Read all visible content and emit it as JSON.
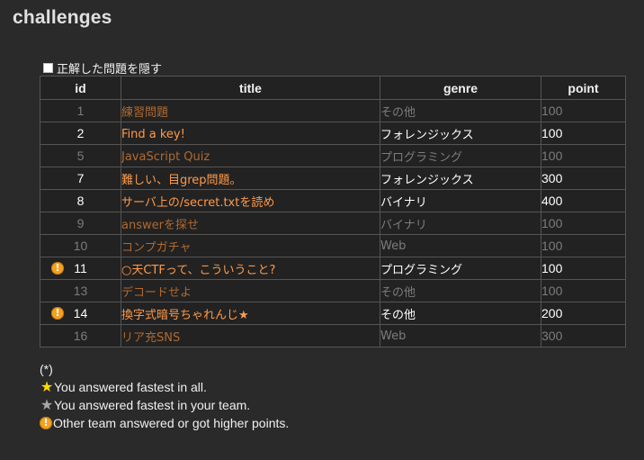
{
  "page": {
    "title": "challenges"
  },
  "filter": {
    "hide_solved_label": "正解した問題を隠す",
    "hide_solved_checked": false
  },
  "table": {
    "headers": {
      "id": "id",
      "title": "title",
      "genre": "genre",
      "point": "point"
    },
    "rows": [
      {
        "id": "1",
        "title": "練習問題",
        "genre": "その他",
        "point": "100",
        "solved": true,
        "warning": false
      },
      {
        "id": "2",
        "title": "Find a key!",
        "genre": "フォレンジックス",
        "point": "100",
        "solved": false,
        "warning": false
      },
      {
        "id": "5",
        "title": "JavaScript Quiz",
        "genre": "プログラミング",
        "point": "100",
        "solved": true,
        "warning": false
      },
      {
        "id": "7",
        "title": "難しい、目grep問題。",
        "genre": "フォレンジックス",
        "point": "300",
        "solved": false,
        "warning": false
      },
      {
        "id": "8",
        "title": "サーバ上の/secret.txtを読め",
        "genre": "バイナリ",
        "point": "400",
        "solved": false,
        "warning": false
      },
      {
        "id": "9",
        "title": "answerを探せ",
        "genre": "バイナリ",
        "point": "100",
        "solved": true,
        "warning": false
      },
      {
        "id": "10",
        "title": "コンプガチャ",
        "genre": "Web",
        "point": "100",
        "solved": true,
        "warning": false
      },
      {
        "id": "11",
        "title": "○天CTFって、こういうこと?",
        "genre": "プログラミング",
        "point": "100",
        "solved": false,
        "warning": true
      },
      {
        "id": "13",
        "title": "デコードせよ",
        "genre": "その他",
        "point": "100",
        "solved": true,
        "warning": false
      },
      {
        "id": "14",
        "title": "換字式暗号ちゃれんじ★",
        "genre": "その他",
        "point": "200",
        "solved": false,
        "warning": true
      },
      {
        "id": "16",
        "title": "リア充SNS",
        "genre": "Web",
        "point": "300",
        "solved": true,
        "warning": false
      }
    ]
  },
  "legend": {
    "note": "(*)",
    "gold_star_text": "You answered fastest in all.",
    "gray_star_text": "You answered fastest in your team.",
    "warning_text": "Other team answered or got higher points."
  },
  "icons": {
    "gold_star": "star-icon",
    "gray_star": "star-icon",
    "warning": "exclamation-circle-icon"
  },
  "colors": {
    "background": "#2a2a2a",
    "table_background": "#222222",
    "solved_title": "#b06a30",
    "open_title": "#ff9a4a",
    "warning_icon": "#f2a323",
    "gold_star": "#ffd800",
    "gray_star": "#a8a8a8"
  }
}
